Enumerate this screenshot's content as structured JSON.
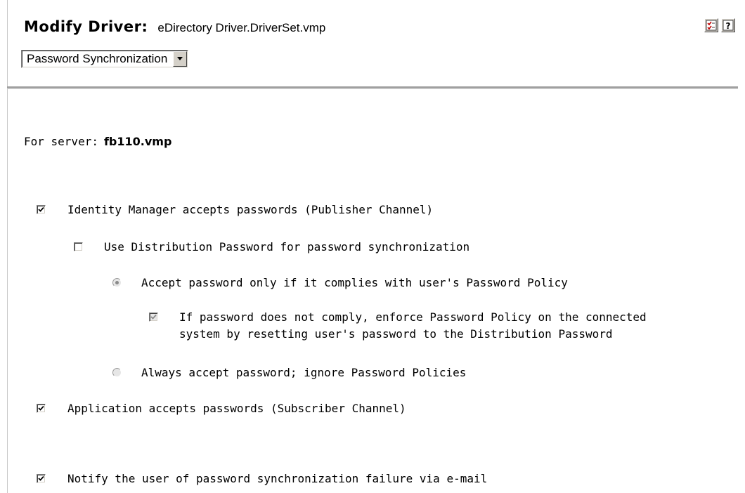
{
  "header": {
    "title_label": "Modify Driver:",
    "driver_name": "eDirectory Driver.DriverSet.vmp",
    "icons": [
      "checklist-icon",
      "help-icon"
    ]
  },
  "page_select": {
    "selected": "Password Synchronization"
  },
  "server": {
    "label": "For server:",
    "name": "fb110.vmp"
  },
  "options": {
    "idm_accepts": {
      "label": "Identity Manager accepts passwords (Publisher Channel)",
      "checked": true
    },
    "use_distribution": {
      "label": "Use Distribution Password for password synchronization",
      "checked": false
    },
    "accept_if_complies": {
      "label": "Accept password only if it complies with user's Password Policy",
      "selected": true,
      "enabled": false
    },
    "enforce_policy": {
      "line1": "If password does not comply, enforce Password Policy on the connected",
      "line2": "system by resetting user's password to the Distribution Password",
      "checked": true,
      "enabled": false
    },
    "always_accept": {
      "label": "Always accept password; ignore Password Policies",
      "selected": false,
      "enabled": false
    },
    "app_accepts": {
      "label": "Application accepts passwords (Subscriber Channel)",
      "checked": true
    },
    "notify_user": {
      "label": "Notify the user of password synchronization failure via e-mail",
      "checked": true
    }
  },
  "colors": {
    "divider": "#a0a0a0",
    "control_face": "#d4d0c8",
    "disabled_mark": "#8a8a8a"
  }
}
